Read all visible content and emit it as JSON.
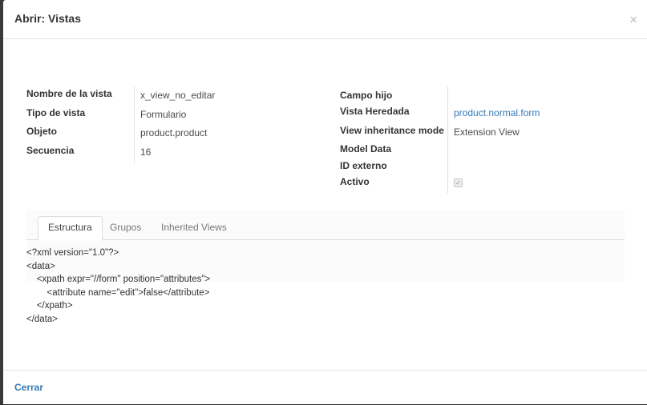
{
  "dialog": {
    "title": "Abrir: Vistas",
    "close_glyph": "×",
    "footer": {
      "close_label": "Cerrar"
    }
  },
  "left_fields": [
    {
      "label": "Nombre de la vista",
      "value": "x_view_no_editar"
    },
    {
      "label": "Tipo de vista",
      "value": "Formulario"
    },
    {
      "label": "Objeto",
      "value": "product.product"
    },
    {
      "label": "Secuencia",
      "value": "16"
    }
  ],
  "right_fields": [
    {
      "label": "Campo hijo",
      "value": ""
    },
    {
      "label": "Vista Heredada",
      "value": "product.normal.form"
    },
    {
      "label": "View inheritance mode",
      "value": "Extension View"
    },
    {
      "label": "Model Data",
      "value": ""
    },
    {
      "label": "ID externo",
      "value": ""
    },
    {
      "label": "Activo",
      "checked": true
    }
  ],
  "tabs": [
    {
      "label": "Estructura",
      "active": true
    },
    {
      "label": "Grupos",
      "active": false
    },
    {
      "label": "Inherited Views",
      "active": false
    }
  ],
  "arch_lines": [
    "<?xml version=\"1.0\"?>",
    "<data>",
    "    <xpath expr=\"//form\" position=\"attributes\">",
    "        <attribute name=\"edit\">false</attribute>",
    "    </xpath>",
    "</data>"
  ],
  "colors": {
    "link": "#337ab7",
    "label": "#333333"
  }
}
